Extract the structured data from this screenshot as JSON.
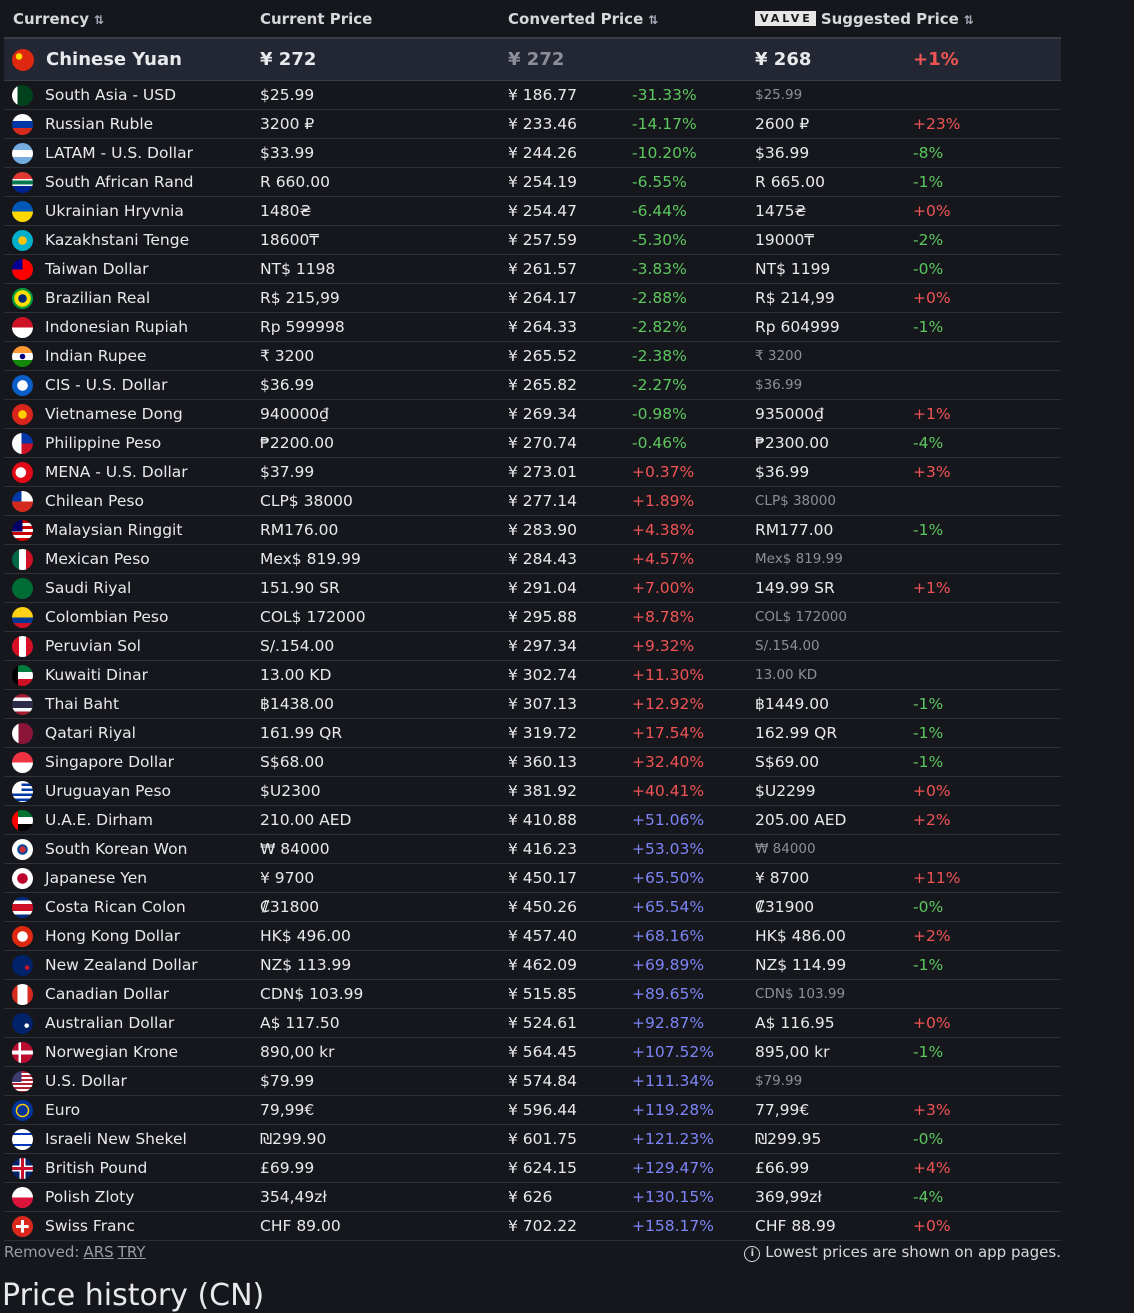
{
  "header": {
    "currency": "Currency",
    "current": "Current Price",
    "converted": "Converted Price",
    "valve_badge": "VALVE",
    "suggested": "Suggested Price",
    "sort_icon": "⇅"
  },
  "colors": {
    "negative": "#5cc75e",
    "positive": "#ee5454",
    "large_positive": "#7c85f5",
    "highlight_bg": "#232733"
  },
  "highlight": {
    "name": "Chinese Yuan",
    "flag": "cn",
    "current": "¥ 272",
    "converted": "¥ 272",
    "converted_muted": true,
    "pct": "",
    "suggested": "¥ 268",
    "diff": "+1%"
  },
  "rows": [
    {
      "name": "South Asia - USD",
      "flag": "pk",
      "current": "$25.99",
      "converted": "¥ 186.77",
      "pct": "-31.33%",
      "suggested": "$25.99",
      "muted": true,
      "diff": ""
    },
    {
      "name": "Russian Ruble",
      "flag": "ru",
      "current": "3200 ₽",
      "converted": "¥ 233.46",
      "pct": "-14.17%",
      "suggested": "2600 ₽",
      "diff": "+23%"
    },
    {
      "name": "LATAM - U.S. Dollar",
      "flag": "ar",
      "current": "$33.99",
      "converted": "¥ 244.26",
      "pct": "-10.20%",
      "suggested": "$36.99",
      "diff": "-8%"
    },
    {
      "name": "South African Rand",
      "flag": "za",
      "current": "R 660.00",
      "converted": "¥ 254.19",
      "pct": "-6.55%",
      "suggested": "R 665.00",
      "diff": "-1%"
    },
    {
      "name": "Ukrainian Hryvnia",
      "flag": "ua",
      "current": "1480₴",
      "converted": "¥ 254.47",
      "pct": "-6.44%",
      "suggested": "1475₴",
      "diff": "+0%"
    },
    {
      "name": "Kazakhstani Tenge",
      "flag": "kz",
      "current": "18600₸",
      "converted": "¥ 257.59",
      "pct": "-5.30%",
      "suggested": "19000₸",
      "diff": "-2%"
    },
    {
      "name": "Taiwan Dollar",
      "flag": "tw",
      "current": "NT$ 1198",
      "converted": "¥ 261.57",
      "pct": "-3.83%",
      "suggested": "NT$ 1199",
      "diff": "-0%"
    },
    {
      "name": "Brazilian Real",
      "flag": "br",
      "current": "R$ 215,99",
      "converted": "¥ 264.17",
      "pct": "-2.88%",
      "suggested": "R$ 214,99",
      "diff": "+0%"
    },
    {
      "name": "Indonesian Rupiah",
      "flag": "id",
      "current": "Rp 599998",
      "converted": "¥ 264.33",
      "pct": "-2.82%",
      "suggested": "Rp 604999",
      "diff": "-1%"
    },
    {
      "name": "Indian Rupee",
      "flag": "in",
      "current": "₹ 3200",
      "converted": "¥ 265.52",
      "pct": "-2.38%",
      "suggested": "₹ 3200",
      "muted": true,
      "diff": ""
    },
    {
      "name": "CIS - U.S. Dollar",
      "flag": "cis",
      "current": "$36.99",
      "converted": "¥ 265.82",
      "pct": "-2.27%",
      "suggested": "$36.99",
      "muted": true,
      "diff": ""
    },
    {
      "name": "Vietnamese Dong",
      "flag": "vn",
      "current": "940000₫",
      "converted": "¥ 269.34",
      "pct": "-0.98%",
      "suggested": "935000₫",
      "diff": "+1%"
    },
    {
      "name": "Philippine Peso",
      "flag": "ph",
      "current": "₱2200.00",
      "converted": "¥ 270.74",
      "pct": "-0.46%",
      "suggested": "₱2300.00",
      "diff": "-4%"
    },
    {
      "name": "MENA - U.S. Dollar",
      "flag": "tr",
      "current": "$37.99",
      "converted": "¥ 273.01",
      "pct": "+0.37%",
      "suggested": "$36.99",
      "diff": "+3%"
    },
    {
      "name": "Chilean Peso",
      "flag": "cl",
      "current": "CLP$ 38000",
      "converted": "¥ 277.14",
      "pct": "+1.89%",
      "suggested": "CLP$ 38000",
      "muted": true,
      "diff": ""
    },
    {
      "name": "Malaysian Ringgit",
      "flag": "my",
      "current": "RM176.00",
      "converted": "¥ 283.90",
      "pct": "+4.38%",
      "suggested": "RM177.00",
      "diff": "-1%"
    },
    {
      "name": "Mexican Peso",
      "flag": "mx",
      "current": "Mex$ 819.99",
      "converted": "¥ 284.43",
      "pct": "+4.57%",
      "suggested": "Mex$ 819.99",
      "muted": true,
      "diff": ""
    },
    {
      "name": "Saudi Riyal",
      "flag": "sa",
      "current": "151.90 SR",
      "converted": "¥ 291.04",
      "pct": "+7.00%",
      "suggested": "149.99 SR",
      "diff": "+1%"
    },
    {
      "name": "Colombian Peso",
      "flag": "co",
      "current": "COL$ 172000",
      "converted": "¥ 295.88",
      "pct": "+8.78%",
      "suggested": "COL$ 172000",
      "muted": true,
      "diff": ""
    },
    {
      "name": "Peruvian Sol",
      "flag": "pe",
      "current": "S/.154.00",
      "converted": "¥ 297.34",
      "pct": "+9.32%",
      "suggested": "S/.154.00",
      "muted": true,
      "diff": ""
    },
    {
      "name": "Kuwaiti Dinar",
      "flag": "kw",
      "current": "13.00 KD",
      "converted": "¥ 302.74",
      "pct": "+11.30%",
      "suggested": "13.00 KD",
      "muted": true,
      "diff": ""
    },
    {
      "name": "Thai Baht",
      "flag": "th",
      "current": "฿1438.00",
      "converted": "¥ 307.13",
      "pct": "+12.92%",
      "suggested": "฿1449.00",
      "diff": "-1%"
    },
    {
      "name": "Qatari Riyal",
      "flag": "qa",
      "current": "161.99 QR",
      "converted": "¥ 319.72",
      "pct": "+17.54%",
      "suggested": "162.99 QR",
      "diff": "-1%"
    },
    {
      "name": "Singapore Dollar",
      "flag": "sg",
      "current": "S$68.00",
      "converted": "¥ 360.13",
      "pct": "+32.40%",
      "suggested": "S$69.00",
      "diff": "-1%"
    },
    {
      "name": "Uruguayan Peso",
      "flag": "uy",
      "current": "$U2300",
      "converted": "¥ 381.92",
      "pct": "+40.41%",
      "suggested": "$U2299",
      "diff": "+0%"
    },
    {
      "name": "U.A.E. Dirham",
      "flag": "ae",
      "current": "210.00 AED",
      "converted": "¥ 410.88",
      "pct": "+51.06%",
      "suggested": "205.00 AED",
      "diff": "+2%"
    },
    {
      "name": "South Korean Won",
      "flag": "kr",
      "current": "₩ 84000",
      "converted": "¥ 416.23",
      "pct": "+53.03%",
      "suggested": "₩ 84000",
      "muted": true,
      "diff": ""
    },
    {
      "name": "Japanese Yen",
      "flag": "jp",
      "current": "¥ 9700",
      "converted": "¥ 450.17",
      "pct": "+65.50%",
      "suggested": "¥ 8700",
      "diff": "+11%"
    },
    {
      "name": "Costa Rican Colon",
      "flag": "cr",
      "current": "₡31800",
      "converted": "¥ 450.26",
      "pct": "+65.54%",
      "suggested": "₡31900",
      "diff": "-0%"
    },
    {
      "name": "Hong Kong Dollar",
      "flag": "hk",
      "current": "HK$ 496.00",
      "converted": "¥ 457.40",
      "pct": "+68.16%",
      "suggested": "HK$ 486.00",
      "diff": "+2%"
    },
    {
      "name": "New Zealand Dollar",
      "flag": "nz",
      "current": "NZ$ 113.99",
      "converted": "¥ 462.09",
      "pct": "+69.89%",
      "suggested": "NZ$ 114.99",
      "diff": "-1%"
    },
    {
      "name": "Canadian Dollar",
      "flag": "ca",
      "current": "CDN$ 103.99",
      "converted": "¥ 515.85",
      "pct": "+89.65%",
      "suggested": "CDN$ 103.99",
      "muted": true,
      "diff": ""
    },
    {
      "name": "Australian Dollar",
      "flag": "au",
      "current": "A$ 117.50",
      "converted": "¥ 524.61",
      "pct": "+92.87%",
      "suggested": "A$ 116.95",
      "diff": "+0%"
    },
    {
      "name": "Norwegian Krone",
      "flag": "no",
      "current": "890,00 kr",
      "converted": "¥ 564.45",
      "pct": "+107.52%",
      "suggested": "895,00 kr",
      "diff": "-1%"
    },
    {
      "name": "U.S. Dollar",
      "flag": "us",
      "current": "$79.99",
      "converted": "¥ 574.84",
      "pct": "+111.34%",
      "suggested": "$79.99",
      "muted": true,
      "diff": ""
    },
    {
      "name": "Euro",
      "flag": "eu",
      "current": "79,99€",
      "converted": "¥ 596.44",
      "pct": "+119.28%",
      "suggested": "77,99€",
      "diff": "+3%"
    },
    {
      "name": "Israeli New Shekel",
      "flag": "il",
      "current": "₪299.90",
      "converted": "¥ 601.75",
      "pct": "+121.23%",
      "suggested": "₪299.95",
      "diff": "-0%"
    },
    {
      "name": "British Pound",
      "flag": "gb",
      "current": "£69.99",
      "converted": "¥ 624.15",
      "pct": "+129.47%",
      "suggested": "£66.99",
      "diff": "+4%"
    },
    {
      "name": "Polish Zloty",
      "flag": "pl",
      "current": "354,49zł",
      "converted": "¥ 626",
      "pct": "+130.15%",
      "suggested": "369,99zł",
      "diff": "-4%"
    },
    {
      "name": "Swiss Franc",
      "flag": "ch",
      "current": "CHF 89.00",
      "converted": "¥ 702.22",
      "pct": "+158.17%",
      "suggested": "CHF 88.99",
      "diff": "+0%"
    }
  ],
  "footer": {
    "removed_label": "Removed:",
    "removed_links": [
      "ARS",
      "TRY"
    ],
    "info_icon": "i",
    "note": "Lowest prices are shown on app pages."
  },
  "next_heading": "Price history (CN)"
}
